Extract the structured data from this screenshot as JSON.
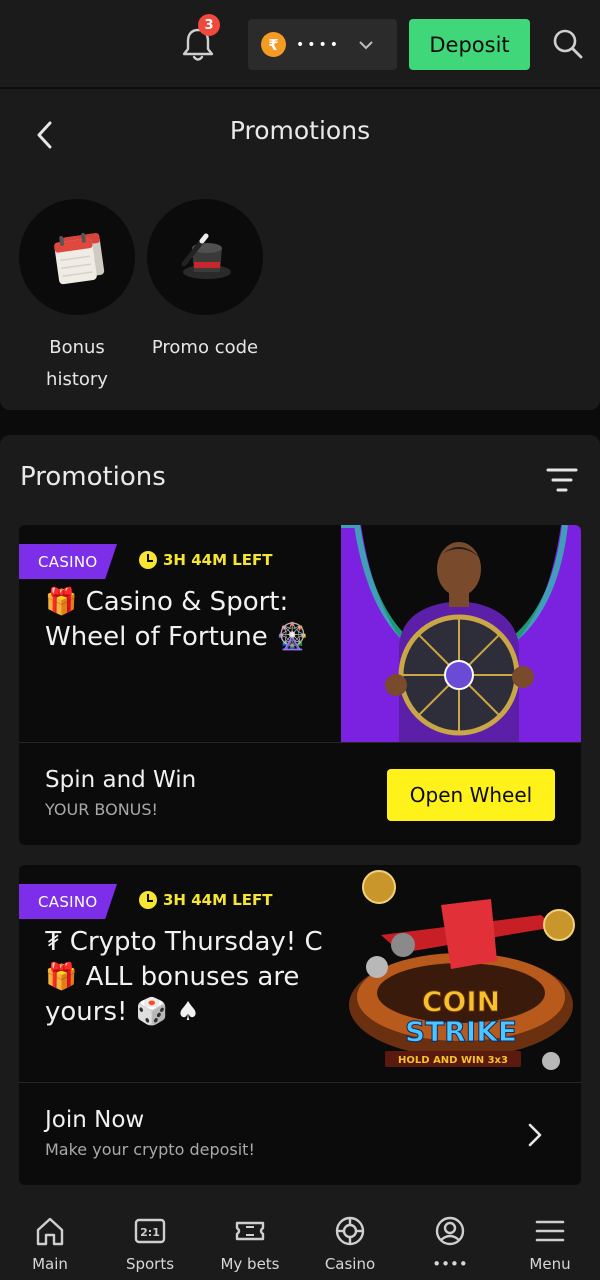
{
  "topbar": {
    "notification_count": "3",
    "currency_symbol": "₹",
    "balance_masked": "••••",
    "deposit_label": "Deposit"
  },
  "header": {
    "title": "Promotions"
  },
  "shortcuts": [
    {
      "label_line1": "Bonus",
      "label_line2": "history",
      "icon": "calendar-icon"
    },
    {
      "label_line1": "Promo code",
      "icon": "magic-hat-icon"
    }
  ],
  "promotions": {
    "title": "Promotions",
    "cards": [
      {
        "tag": "CASINO",
        "time_left": "3H 44M LEFT",
        "title_line1": "🎁 Casino & Sport:",
        "title_line2": "Wheel of Fortune 🎡",
        "bottom_title": "Spin and Win",
        "bottom_subtitle": "YOUR BONUS!",
        "action_label": "Open Wheel"
      },
      {
        "tag": "CASINO",
        "time_left": "3H 44M LEFT",
        "title_line1": "₮ Crypto Thursday! C",
        "title_line2": "🎁 ALL bonuses are",
        "title_line3": "yours! 🎲 ♠",
        "art_text1": "COIN",
        "art_text2": "STRIKE",
        "art_text3": "HOLD AND WIN 3x3",
        "bottom_title": "Join Now",
        "bottom_subtitle": "Make your crypto deposit!"
      }
    ]
  },
  "bottom_nav": [
    {
      "label": "Main",
      "icon": "home-icon"
    },
    {
      "label": "Sports",
      "icon": "scoreboard-icon"
    },
    {
      "label": "My bets",
      "icon": "ticket-icon"
    },
    {
      "label": "Casino",
      "icon": "chip-icon"
    },
    {
      "label": "••••",
      "icon": "profile-icon"
    },
    {
      "label": "Menu",
      "icon": "menu-icon"
    }
  ],
  "colors": {
    "accent_green": "#3fd77a",
    "accent_yellow": "#fff21a",
    "tag_purple": "#7c2ee8",
    "badge_red": "#ef4a3c",
    "background": "#0b0b0b",
    "panel": "#1b1b1b"
  }
}
